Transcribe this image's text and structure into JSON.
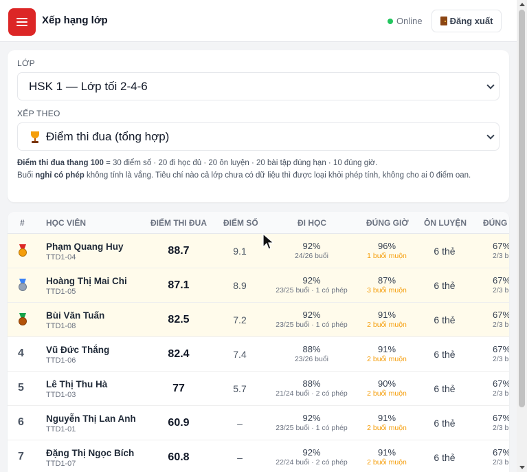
{
  "header": {
    "title": "Xếp hạng lớp",
    "status": "Online",
    "logout_label": "Đăng xuất"
  },
  "filters": {
    "class_label": "LỚP",
    "class_value": "HSK 1 — Lớp tối 2-4-6",
    "sort_label": "XẾP THEO",
    "sort_value": "Điểm thi đua (tổng hợp)",
    "note_bold1": "Điểm thi đua thang 100",
    "note_rest1": " = 30 điểm số · 20 đi học đủ · 20 ôn luyện · 20 bài tập đúng hạn · 10 đúng giờ.",
    "note_pre2": "Buổi ",
    "note_bold2": "nghỉ có phép",
    "note_rest2": " không tính là vắng. Tiêu chí nào cả lớp chưa có dữ liệu thì được loại khỏi phép tính, không cho ai 0 điểm oan."
  },
  "table": {
    "headers": {
      "rank": "#",
      "student": "HỌC VIÊN",
      "score": "ĐIỂM THI ĐUA",
      "points": "ĐIỂM SỐ",
      "attendance": "ĐI HỌC",
      "punctuality": "ĐÚNG GIỜ",
      "review": "ÔN LUYỆN",
      "homework": "ĐÚNG"
    },
    "rows": [
      {
        "rank": "1",
        "name": "Phạm Quang Huy",
        "code": "TTD1-04",
        "score": "88.7",
        "points": "9.1",
        "att_pct": "92%",
        "att_sub": "24/26 buổi",
        "punc_pct": "96%",
        "punc_late": "1 buổi muộn",
        "review": "6 thẻ",
        "hw_pct": "67%",
        "hw_sub": "2/3 b"
      },
      {
        "rank": "2",
        "name": "Hoàng Thị Mai Chi",
        "code": "TTD1-05",
        "score": "87.1",
        "points": "8.9",
        "att_pct": "92%",
        "att_sub": "23/25 buổi · 1 có phép",
        "punc_pct": "87%",
        "punc_late": "3 buổi muộn",
        "review": "6 thẻ",
        "hw_pct": "67%",
        "hw_sub": "2/3 b"
      },
      {
        "rank": "3",
        "name": "Bùi Văn Tuấn",
        "code": "TTD1-08",
        "score": "82.5",
        "points": "7.2",
        "att_pct": "92%",
        "att_sub": "23/25 buổi · 1 có phép",
        "punc_pct": "91%",
        "punc_late": "2 buổi muộn",
        "review": "6 thẻ",
        "hw_pct": "67%",
        "hw_sub": "2/3 b"
      },
      {
        "rank": "4",
        "name": "Vũ Đức Thắng",
        "code": "TTD1-06",
        "score": "82.4",
        "points": "7.4",
        "att_pct": "88%",
        "att_sub": "23/26 buổi",
        "punc_pct": "91%",
        "punc_late": "2 buổi muộn",
        "review": "6 thẻ",
        "hw_pct": "67%",
        "hw_sub": "2/3 b"
      },
      {
        "rank": "5",
        "name": "Lê Thị Thu Hà",
        "code": "TTD1-03",
        "score": "77",
        "points": "5.7",
        "att_pct": "88%",
        "att_sub": "21/24 buổi · 2 có phép",
        "punc_pct": "90%",
        "punc_late": "2 buổi muộn",
        "review": "6 thẻ",
        "hw_pct": "67%",
        "hw_sub": "2/3 b"
      },
      {
        "rank": "6",
        "name": "Nguyễn Thị Lan Anh",
        "code": "TTD1-01",
        "score": "60.9",
        "points": "–",
        "att_pct": "92%",
        "att_sub": "23/25 buổi · 1 có phép",
        "punc_pct": "91%",
        "punc_late": "2 buổi muộn",
        "review": "6 thẻ",
        "hw_pct": "67%",
        "hw_sub": "2/3 b"
      },
      {
        "rank": "7",
        "name": "Đặng Thị Ngọc Bích",
        "code": "TTD1-07",
        "score": "60.8",
        "points": "–",
        "att_pct": "92%",
        "att_sub": "22/24 buổi · 2 có phép",
        "punc_pct": "91%",
        "punc_late": "2 buổi muộn",
        "review": "6 thẻ",
        "hw_pct": "67%",
        "hw_sub": "2/3 b"
      }
    ]
  },
  "colors": {
    "accent": "#dc2626",
    "online": "#22c55e",
    "late": "#f59e0b",
    "top3_row": "#fffbeb",
    "gold": "#f59e0b",
    "silver": "#94a3b8",
    "bronze": "#b45309"
  }
}
